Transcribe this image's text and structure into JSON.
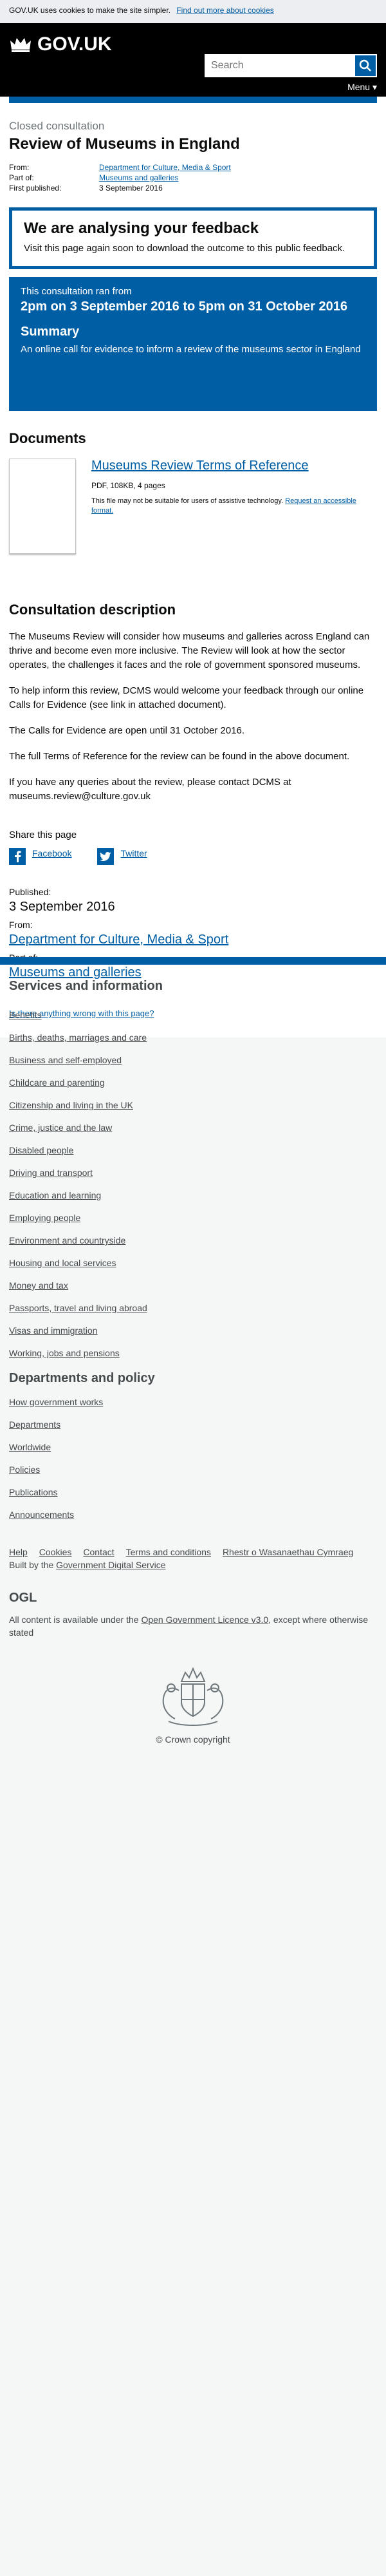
{
  "cookie": {
    "text": "GOV.UK uses cookies to make the site simpler.",
    "link": "Find out more about cookies"
  },
  "header": {
    "logo_text": "GOV.UK",
    "search_placeholder": "Search",
    "menu_label": "Menu ▾"
  },
  "page": {
    "caption": "Closed consultation",
    "title": "Review of Museums in England",
    "meta": [
      {
        "key": "From:",
        "value": "Department for Culture, Media & Sport"
      },
      {
        "key": "Part of:",
        "value": "Museums and galleries"
      },
      {
        "key": "First published:",
        "value": "3 September 2016"
      }
    ]
  },
  "feedback": {
    "heading": "We are analysing your feedback",
    "text": "Visit this page again soon to download the outcome to this public feedback."
  },
  "consultation": {
    "ran_from": "This consultation ran from",
    "dates": "2pm on 3 September 2016 to 5pm on 31 October 2016",
    "summary_heading": "Summary",
    "summary_text": "An online call for evidence to inform a review of the museums sector in England"
  },
  "documents": {
    "heading": "Documents",
    "item_title": "Museums Review Terms of Reference",
    "item_meta": "PDF, 108KB, 4 pages",
    "item_note": "This file may not be suitable for users of assistive technology.",
    "item_note_link": "Request an accessible format."
  },
  "description": {
    "heading": "Consultation description",
    "paragraphs": [
      "The Museums Review will consider how museums and galleries across England can thrive and become even more inclusive. The Review will look at how the sector operates, the challenges it faces and the role of government sponsored museums.",
      "To help inform this review, DCMS would welcome your feedback through our online Calls for Evidence (see link in attached document).",
      "The Calls for Evidence are open until 31 October 2016.",
      "The full Terms of Reference for the review can be found in the above document.",
      "If you have any queries about the review, please contact DCMS at museums.review@culture.gov.uk"
    ]
  },
  "share": {
    "title": "Share this page",
    "facebook": "Facebook",
    "twitter": "Twitter"
  },
  "publication": {
    "published_label": "Published:",
    "published_value": "3 September 2016",
    "from_label": "From:",
    "from_value": "Department for Culture, Media & Sport",
    "partof_label": "Part of:",
    "partof_value": "Museums and galleries",
    "report_link": "Is there anything wrong with this page?"
  },
  "footer": {
    "services_heading": "Services and information",
    "services": [
      "Benefits",
      "Births, deaths, marriages and care",
      "Business and self-employed",
      "Childcare and parenting",
      "Citizenship and living in the UK",
      "Crime, justice and the law",
      "Disabled people",
      "Driving and transport",
      "Education and learning",
      "Employing people",
      "Environment and countryside",
      "Housing and local services",
      "Money and tax",
      "Passports, travel and living abroad",
      "Visas and immigration",
      "Working, jobs and pensions"
    ],
    "departments_heading": "Departments and policy",
    "departments": [
      "How government works",
      "Departments",
      "Worldwide",
      "Policies",
      "Publications",
      "Announcements"
    ],
    "bottom_links": [
      "Help",
      "Cookies",
      "Contact",
      "Terms and conditions",
      "Rhestr o Wasanaethau Cymraeg"
    ],
    "built_by_prefix": "Built by the",
    "built_by_link": "Government Digital Service",
    "ogl": "OGL",
    "licence_prefix": "All content is available under the",
    "licence_link": "Open Government Licence v3.0",
    "licence_suffix": ", except where otherwise stated",
    "copyright": "© Crown copyright"
  },
  "colors": {
    "brand_blue": "#005ea5",
    "header_black": "#000000",
    "footer_grey": "#dee0e2"
  }
}
